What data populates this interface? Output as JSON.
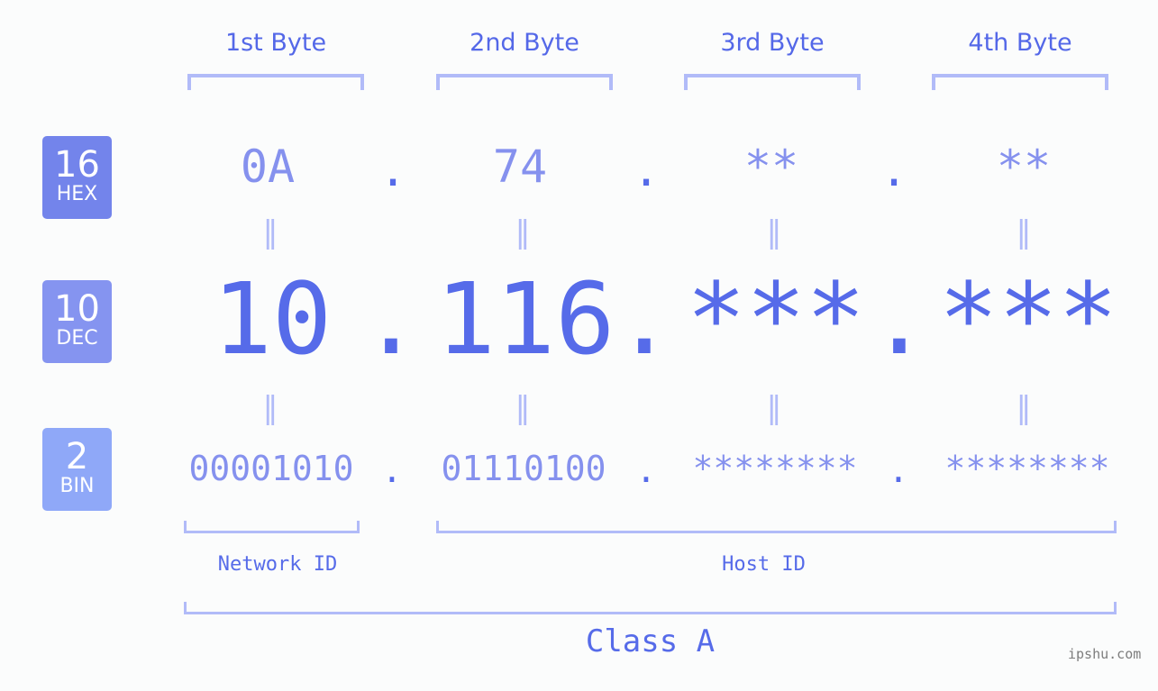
{
  "bytes": [
    {
      "header": "1st Byte",
      "hex": "0A",
      "dec": "10",
      "bin": "00001010"
    },
    {
      "header": "2nd Byte",
      "hex": "74",
      "dec": "116",
      "bin": "01110100"
    },
    {
      "header": "3rd Byte",
      "hex": "**",
      "dec": "***",
      "bin": "********"
    },
    {
      "header": "4th Byte",
      "hex": "**",
      "dec": "***",
      "bin": "********"
    }
  ],
  "separator": ".",
  "equals": "=",
  "badges": {
    "hex": {
      "num": "16",
      "label": "HEX",
      "color": "#7384eb"
    },
    "dec": {
      "num": "10",
      "label": "DEC",
      "color": "#8594f0"
    },
    "bin": {
      "num": "2",
      "label": "BIN",
      "color": "#8fa8f8"
    }
  },
  "network_id_label": "Network ID",
  "host_id_label": "Host ID",
  "class_label": "Class A",
  "watermark": "ipshu.com"
}
